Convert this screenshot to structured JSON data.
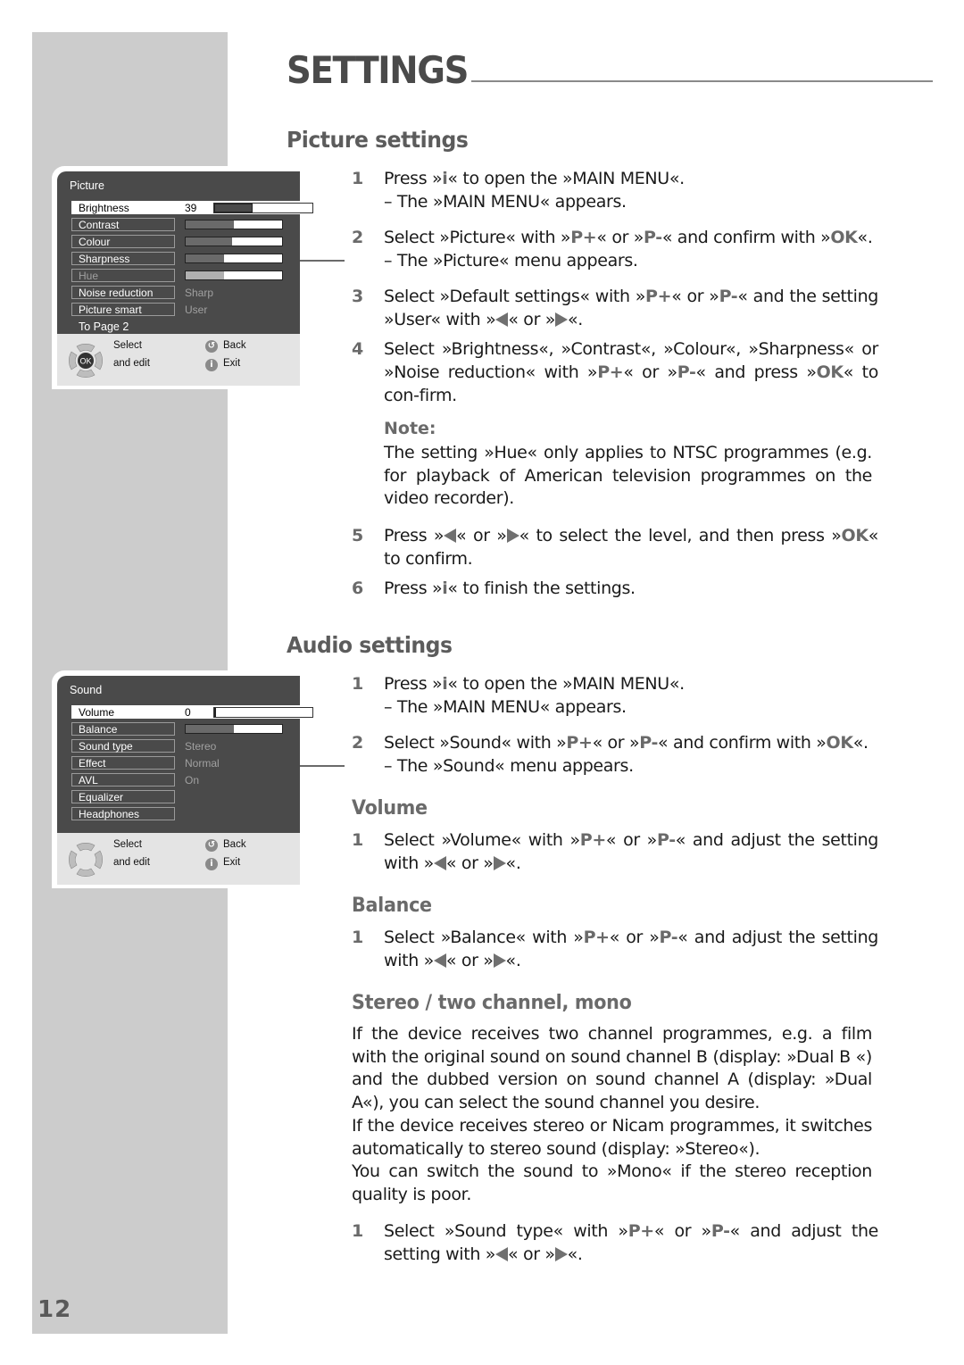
{
  "page": {
    "title": "SETTINGS",
    "number": "12"
  },
  "picture": {
    "heading": "Picture settings",
    "menu": {
      "title": "Picture",
      "rows": [
        {
          "label": "Brightness",
          "value": "39",
          "level": 0.39,
          "selected": true
        },
        {
          "label": "Contrast",
          "level": 0.5
        },
        {
          "label": "Colour",
          "level": 0.48
        },
        {
          "label": "Sharpness",
          "level": 0.4
        },
        {
          "label": "Hue",
          "level": 0.4,
          "disabled": true
        },
        {
          "label": "Noise reduction",
          "value": "Sharp"
        },
        {
          "label": "Picture smart",
          "value": "User"
        }
      ],
      "to_page": "To Page 2",
      "footer": {
        "select": "Select",
        "and_edit": "and edit",
        "back": "Back",
        "exit": "Exit",
        "ok": "OK"
      }
    },
    "steps": [
      {
        "num": "1",
        "html": "Press »<span class=\"key\">i</span>« to open the »MAIN MENU«.<br>– The »MAIN MENU« appears."
      },
      {
        "num": "2",
        "html": "Select »Picture« with »<span class=\"key\">P+</span>« or »<span class=\"key\">P-</span>« and confirm with »<span class=\"key\">OK</span>«.<br>– The »Picture« menu appears."
      },
      {
        "num": "3",
        "html": "Select »Default settings« with »<span class=\"key\">P+</span>« or »<span class=\"key\">P-</span>« and the setting »User« with »<span class=\"arr l\"></span>« or »<span class=\"arr r\"></span>«."
      },
      {
        "num": "4",
        "html": "Select »Brightness«, »Contrast«, »Colour«, »Sharpness« or »Noise reduction« with »<span class=\"key\">P+</span>« or »<span class=\"key\">P-</span>« and press »<span class=\"key\">OK</span>« to con-firm."
      },
      {
        "num": "5",
        "html": "Press »<span class=\"arr l\"></span>« or »<span class=\"arr r\"></span>« to select the level, and then press »<span class=\"key\">OK</span>« to confirm."
      },
      {
        "num": "6",
        "html": "Press »<span class=\"key\">i</span>« to finish the settings."
      }
    ],
    "note_label": "Note:",
    "note_text": "The setting »Hue« only applies to NTSC programmes (e.g. for playback of American television programmes on the video recorder)."
  },
  "audio": {
    "heading": "Audio settings",
    "menu": {
      "title": "Sound",
      "rows": [
        {
          "label": "Volume",
          "value": "0",
          "level": 0.0,
          "selected": true
        },
        {
          "label": "Balance",
          "level": 0.5
        },
        {
          "label": "Sound type",
          "value": "Stereo"
        },
        {
          "label": "Effect",
          "value": "Normal"
        },
        {
          "label": "AVL",
          "value": "On"
        },
        {
          "label": "Equalizer"
        },
        {
          "label": "Headphones"
        }
      ],
      "footer": {
        "select": "Select",
        "and_edit": "and edit",
        "back": "Back",
        "exit": "Exit"
      }
    },
    "steps": [
      {
        "num": "1",
        "html": "Press »<span class=\"key\">i</span>« to open the »MAIN MENU«.<br>– The »MAIN MENU« appears."
      },
      {
        "num": "2",
        "html": "Select »Sound« with »<span class=\"key\">P+</span>« or »<span class=\"key\">P-</span>« and confirm with »<span class=\"key\">OK</span>«.<br>– The »Sound« menu appears."
      }
    ],
    "volume": {
      "heading": "Volume",
      "step": {
        "num": "1",
        "html": "Select »Volume« with »<span class=\"key\">P+</span>« or »<span class=\"key\">P-</span>« and adjust the setting with »<span class=\"arr l\"></span>« or »<span class=\"arr r\"></span>«."
      }
    },
    "balance": {
      "heading": "Balance",
      "step": {
        "num": "1",
        "html": "Select »Balance« with »<span class=\"key\">P+</span>« or »<span class=\"key\">P-</span>« and adjust the setting with »<span class=\"arr l\"></span>« or »<span class=\"arr r\"></span>«."
      }
    },
    "stereo": {
      "heading": "Stereo / two channel, mono",
      "paragraphs": [
        "If the device receives two channel programmes, e.g. a film with the original sound on sound channel B (display: »Dual B «) and the dubbed version on sound channel A (display: »Dual A«), you can select the sound channel you desire.",
        "If the device receives stereo or Nicam programmes, it switches automatically to stereo sound (display: »Stereo«).",
        "You can switch the sound to »Mono« if the stereo reception quality is poor."
      ],
      "step": {
        "num": "1",
        "html": "Select »Sound type« with »<span class=\"key\">P+</span>« or »<span class=\"key\">P-</span>« and adjust the setting with »<span class=\"arr l\"></span>« or »<span class=\"arr r\"></span>«."
      }
    }
  }
}
